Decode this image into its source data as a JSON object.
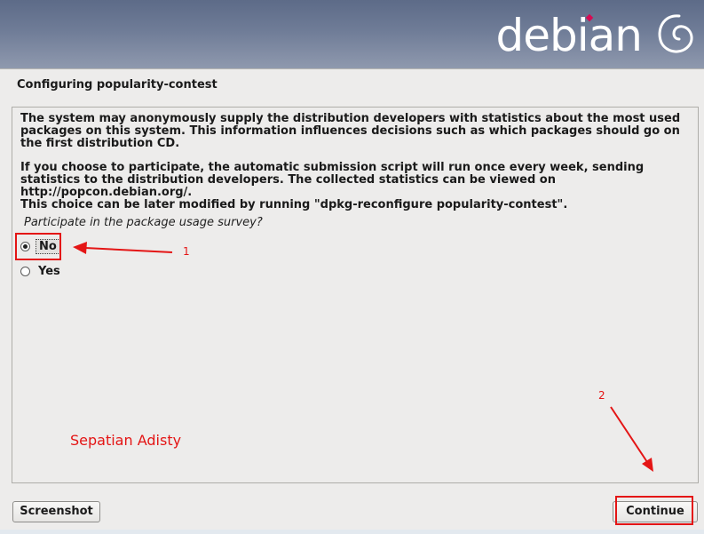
{
  "header": {
    "brand": "debian",
    "logo_icon": "debian-swirl-icon",
    "brand_accent_color": "#d70a53"
  },
  "step_title": "Configuring popularity-contest",
  "content": {
    "paragraph_1": "The system may anonymously supply the distribution developers with statistics about the most used packages on this system. This information influences decisions such as which packages should go on the first distribution CD.",
    "paragraph_2": "If you choose to participate, the automatic submission script will run once every week, sending statistics to the distribution developers. The collected statistics can be viewed on http://popcon.debian.org/.",
    "paragraph_3": "This choice can be later modified by running \"dpkg-reconfigure popularity-contest\".",
    "question": "Participate in the package usage survey?",
    "options": [
      {
        "label": "No",
        "selected": true
      },
      {
        "label": "Yes",
        "selected": false
      }
    ]
  },
  "buttons": {
    "screenshot": "Screenshot",
    "continue": "Continue"
  },
  "annotations": {
    "marker_1": "1",
    "marker_2": "2",
    "author": "Sepatian Adisty",
    "color": "#e41515"
  }
}
